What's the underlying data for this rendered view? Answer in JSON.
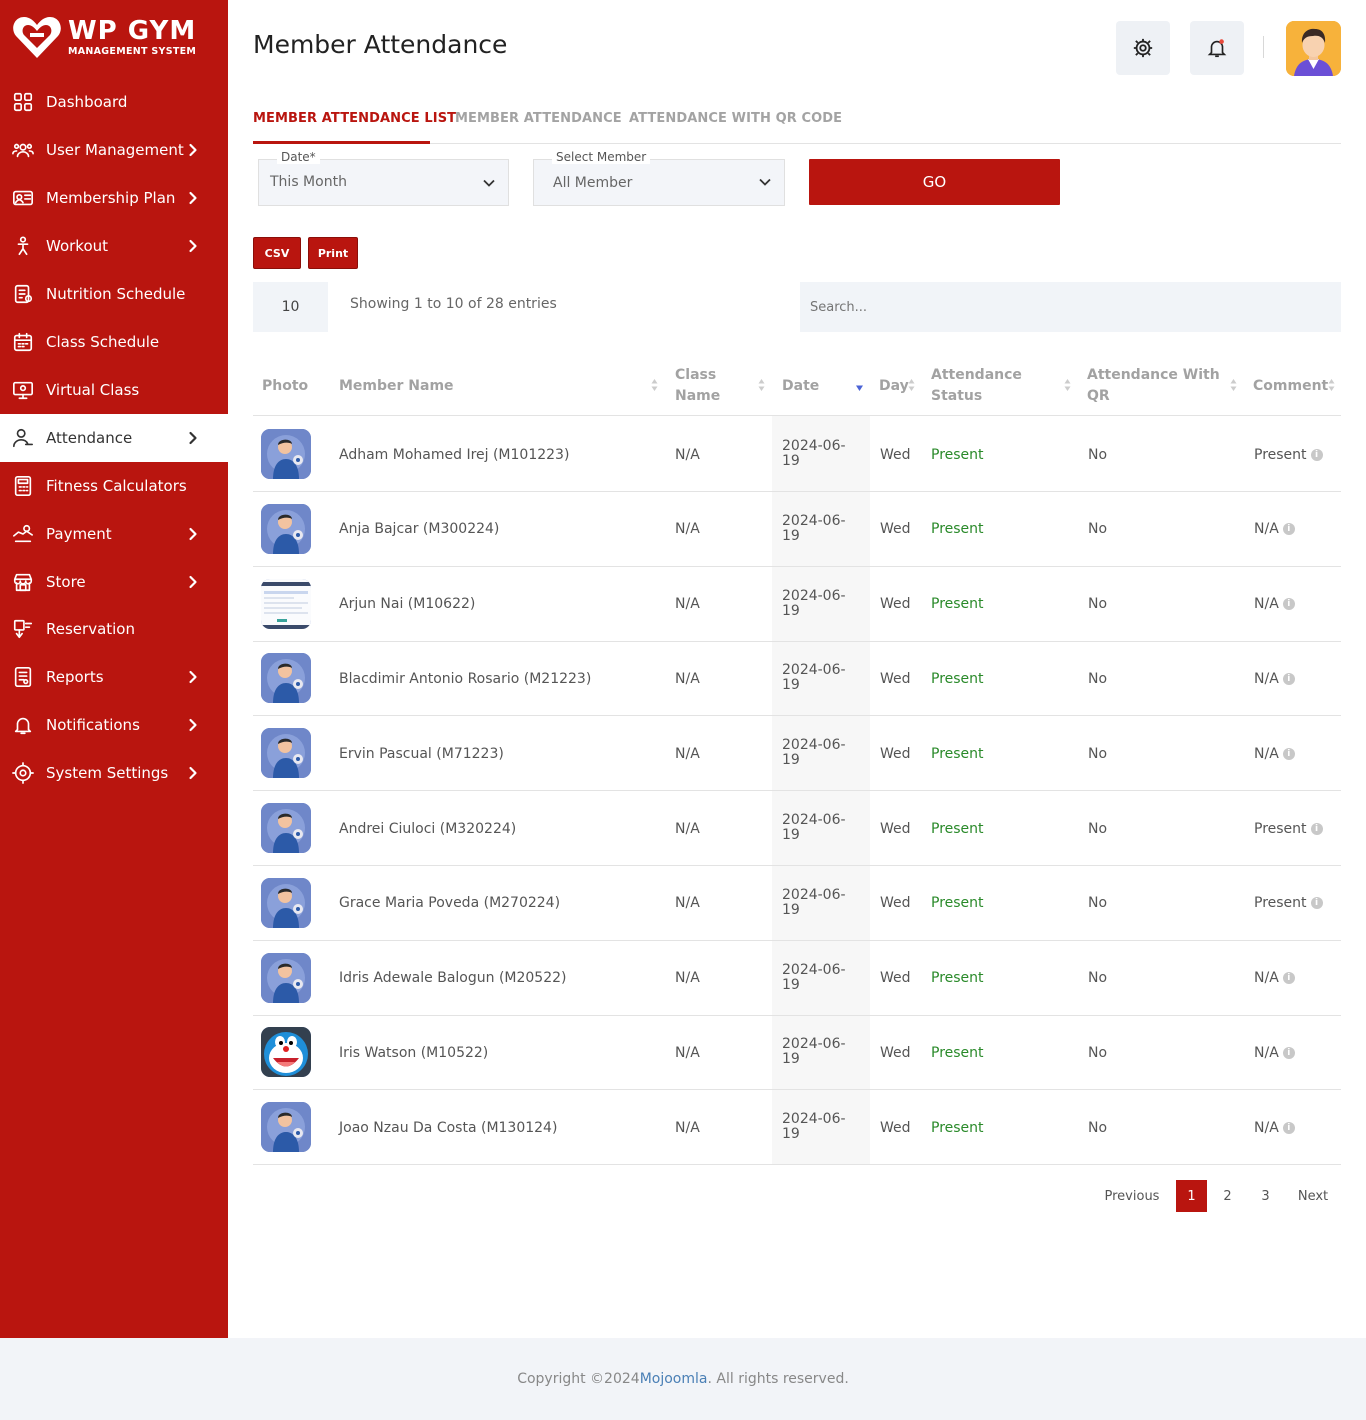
{
  "brand": {
    "title": "WP GYM",
    "subtitle": "MANAGEMENT SYSTEM"
  },
  "sidebar": {
    "items": [
      {
        "label": "Dashboard",
        "icon": "dashboard-icon",
        "chevron": false
      },
      {
        "label": "User Management",
        "icon": "users-icon",
        "chevron": true
      },
      {
        "label": "Membership Plan",
        "icon": "id-card-icon",
        "chevron": true
      },
      {
        "label": "Workout",
        "icon": "workout-icon",
        "chevron": true
      },
      {
        "label": "Nutrition Schedule",
        "icon": "nutrition-icon",
        "chevron": false
      },
      {
        "label": "Class Schedule",
        "icon": "calendar-icon",
        "chevron": false
      },
      {
        "label": "Virtual Class",
        "icon": "virtual-class-icon",
        "chevron": false
      },
      {
        "label": "Attendance",
        "icon": "attendance-icon",
        "chevron": true,
        "active": true
      },
      {
        "label": "Fitness Calculators",
        "icon": "calculator-icon",
        "chevron": false
      },
      {
        "label": "Payment",
        "icon": "payment-icon",
        "chevron": true
      },
      {
        "label": "Store",
        "icon": "store-icon",
        "chevron": true
      },
      {
        "label": "Reservation",
        "icon": "reservation-icon",
        "chevron": false
      },
      {
        "label": "Reports",
        "icon": "reports-icon",
        "chevron": true
      },
      {
        "label": "Notifications",
        "icon": "bell-icon",
        "chevron": true
      },
      {
        "label": "System Settings",
        "icon": "settings-icon",
        "chevron": true
      }
    ]
  },
  "header": {
    "title": "Member Attendance"
  },
  "tabs": [
    {
      "label": "MEMBER ATTENDANCE LIST",
      "active": true
    },
    {
      "label": "MEMBER ATTENDANCE",
      "active": false
    },
    {
      "label": "ATTENDANCE WITH QR CODE",
      "active": false
    }
  ],
  "filters": {
    "date_label": "Date*",
    "date_value": "This Month",
    "member_label": "Select Member",
    "member_value": "All Member",
    "go_label": "GO"
  },
  "actions": {
    "csv_label": "CSV",
    "print_label": "Print"
  },
  "table_controls": {
    "page_length": "10",
    "showing_text": "Showing 1 to 10 of 28 entries",
    "search_placeholder": "Search..."
  },
  "table": {
    "headers": [
      "Photo",
      "Member Name",
      "Class Name",
      "Date",
      "Day",
      "Attendance Status",
      "Attendance With QR",
      "Comment"
    ],
    "rows": [
      {
        "photo": "gym-avatar",
        "name": "Adham Mohamed Irej (M101223)",
        "class": "N/A",
        "date": "2024-06-19",
        "day": "Wed",
        "status": "Present",
        "qr": "No",
        "comment": "Present"
      },
      {
        "photo": "gym-avatar",
        "name": "Anja Bajcar (M300224)",
        "class": "N/A",
        "date": "2024-06-19",
        "day": "Wed",
        "status": "Present",
        "qr": "No",
        "comment": "N/A"
      },
      {
        "photo": "screenshot-thumb",
        "name": "Arjun Nai (M10622)",
        "class": "N/A",
        "date": "2024-06-19",
        "day": "Wed",
        "status": "Present",
        "qr": "No",
        "comment": "N/A"
      },
      {
        "photo": "gym-avatar",
        "name": "Blacdimir Antonio Rosario (M21223)",
        "class": "N/A",
        "date": "2024-06-19",
        "day": "Wed",
        "status": "Present",
        "qr": "No",
        "comment": "N/A"
      },
      {
        "photo": "gym-avatar",
        "name": "Ervin Pascual (M71223)",
        "class": "N/A",
        "date": "2024-06-19",
        "day": "Wed",
        "status": "Present",
        "qr": "No",
        "comment": "N/A"
      },
      {
        "photo": "gym-avatar",
        "name": "Andrei Ciuloci (M320224)",
        "class": "N/A",
        "date": "2024-06-19",
        "day": "Wed",
        "status": "Present",
        "qr": "No",
        "comment": "Present"
      },
      {
        "photo": "gym-avatar",
        "name": "Grace Maria Poveda (M270224)",
        "class": "N/A",
        "date": "2024-06-19",
        "day": "Wed",
        "status": "Present",
        "qr": "No",
        "comment": "Present"
      },
      {
        "photo": "gym-avatar",
        "name": "Idris Adewale Balogun (M20522)",
        "class": "N/A",
        "date": "2024-06-19",
        "day": "Wed",
        "status": "Present",
        "qr": "No",
        "comment": "N/A"
      },
      {
        "photo": "cartoon-avatar",
        "name": "Iris Watson (M10522)",
        "class": "N/A",
        "date": "2024-06-19",
        "day": "Wed",
        "status": "Present",
        "qr": "No",
        "comment": "N/A"
      },
      {
        "photo": "gym-avatar",
        "name": "Joao Nzau Da Costa (M130124)",
        "class": "N/A",
        "date": "2024-06-19",
        "day": "Wed",
        "status": "Present",
        "qr": "No",
        "comment": "N/A"
      }
    ]
  },
  "pagination": {
    "previous": "Previous",
    "pages": [
      "1",
      "2",
      "3"
    ],
    "current": "1",
    "next": "Next"
  },
  "footer": {
    "prefix": "Copyright ©2024 ",
    "brand": "Mojoomla",
    "suffix": ". All rights reserved."
  },
  "colors": {
    "primary": "#b9150f",
    "present": "#2a8a2a"
  }
}
